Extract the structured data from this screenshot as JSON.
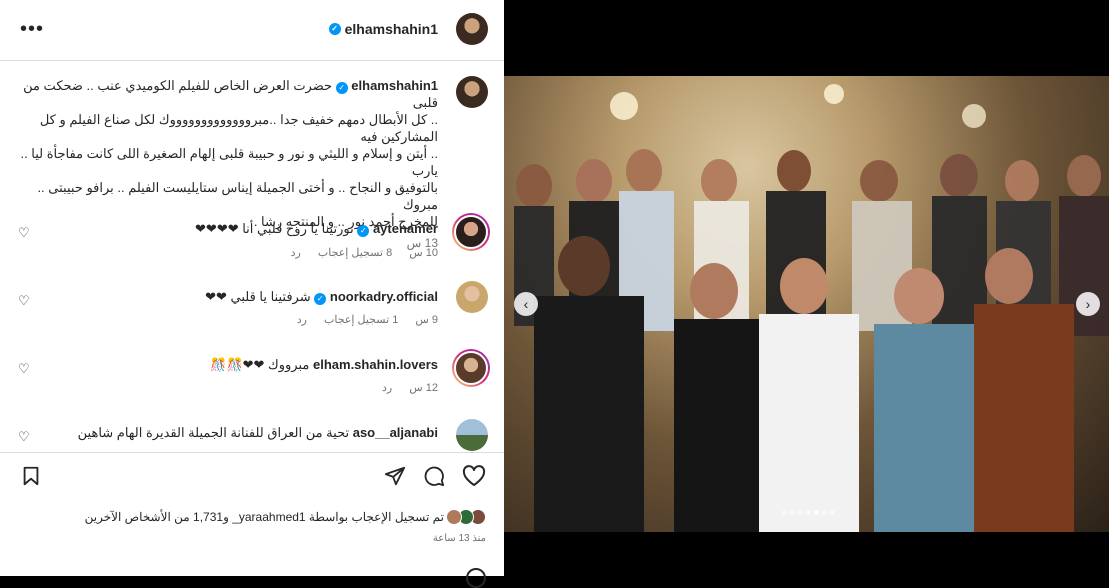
{
  "header": {
    "username": "elhamshahin1",
    "more_label": "•••"
  },
  "caption": {
    "username": "elhamshahin1",
    "lines": [
      "حضرت العرض الخاص للفيلم الكوميدي عنب .. ضحكت من قلبى",
      ".. كل الأبطال دمهم خفيف جدا ..مبروووووووووووووك لكل صناع الفيلم و كل المشاركين فيه",
      ".. أيتن و إسلام و الليثي و نور و حبيبة قلبى إلهام الصغيرة اللى كانت مفاجأة ليا .. يارب",
      "بالتوفيق و النجاح .. و أختى الجميلة إيناس ستايليست الفيلم .. برافو حبيبتى .. مبروك",
      "للمخرج أحمد نور .. و المنتجه رشا ."
    ],
    "time": "13 س"
  },
  "comments": [
    {
      "username": "aytenamer",
      "text": "نورتينا يا روح قلبي أنا ❤❤❤❤",
      "time": "10 س",
      "likes": "8 تسجيل إعجاب",
      "reply": "رد",
      "verified": true,
      "ring": true
    },
    {
      "username": "noorkadry.official",
      "text": "شرفتينا يا قلبي ❤❤",
      "time": "9 س",
      "likes": "1 تسجيل إعجاب",
      "reply": "رد",
      "verified": true,
      "ring": false
    },
    {
      "username": "elham.shahin.lovers",
      "text": "مبرووك ❤❤🎊🎊",
      "time": "12 س",
      "likes": "",
      "reply": "رد",
      "verified": false,
      "ring": true
    },
    {
      "username": "aso__aljanabi",
      "text": "تحية من العراق للفنانة الجميلة القديرة الهام شاهين",
      "time": "",
      "likes": "",
      "reply": "",
      "verified": false,
      "ring": false
    }
  ],
  "likes_summary": "تم تسجيل الإعجاب بواسطة yaraahmed1_ و1,731 من الأشخاص الآخرين",
  "post_age": "منذ 13 ساعة",
  "icons": {
    "more": "more-icon",
    "bookmark": "bookmark-icon",
    "share": "share-icon",
    "comment": "comment-icon",
    "like": "heart-icon",
    "prev": "chevron-left-icon",
    "next": "chevron-right-icon"
  },
  "colors": {
    "verified": "#0095f6",
    "text": "#262626",
    "muted": "#737373"
  },
  "carousel": {
    "count": 7,
    "active": 4
  }
}
